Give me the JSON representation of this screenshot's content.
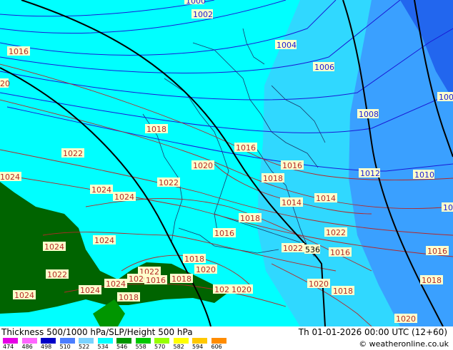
{
  "footer": {
    "title": "Thickness 500/1000 hPa/SLP/Height 500 hPa",
    "datetime": "Th 01-01-2026 00:00 UTC (12+60)",
    "credit": "© weatheronline.co.uk"
  },
  "legend": {
    "ticks": [
      "474",
      "486",
      "498",
      "510",
      "522",
      "534",
      "546",
      "558",
      "570",
      "582",
      "594",
      "606"
    ],
    "colors": [
      "#e600e6",
      "#ff66ff",
      "#0000c8",
      "#4b7dff",
      "#7ad2ff",
      "#00ffff",
      "#009600",
      "#00c800",
      "#96ff00",
      "#ffff00",
      "#ffc800",
      "#ff8c00"
    ]
  },
  "map": {
    "colors": {
      "cyan": "#00ffff",
      "light_blue": "#30d8ff",
      "mid_blue": "#3aa0ff",
      "deep_blue": "#2266ee",
      "green": "#006400",
      "isobar_blue": "#1a1ad6",
      "isobar_red": "#b42828",
      "height_line": "#000000",
      "label_bg": "#ffffcc"
    },
    "slp_labels_blue": [
      "1000",
      "1002",
      "1004",
      "1006",
      "1008",
      "1010",
      "1012",
      "100",
      "100"
    ],
    "slp_labels_red": [
      "1016",
      "1018",
      "1016",
      "1020",
      "1022",
      "1022",
      "1024",
      "1024",
      "1024",
      "1024",
      "1018",
      "1016",
      "1014",
      "1014",
      "1018",
      "1016",
      "1022",
      "1022",
      "1016",
      "1018",
      "1020",
      "1022",
      "1020",
      "1016",
      "1018",
      "1024",
      "1024",
      "1024",
      "1022",
      "1022",
      "1018",
      "1020",
      "1021",
      "1020",
      "1018",
      "1018",
      "1016",
      "1020"
    ],
    "height_label": "536",
    "partial_labels": [
      "20",
      "1024"
    ]
  }
}
